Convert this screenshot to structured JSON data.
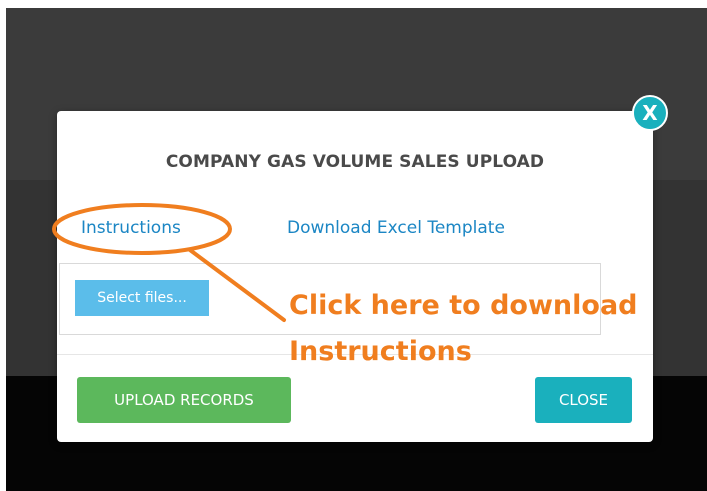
{
  "modal": {
    "title": "COMPANY GAS VOLUME SALES UPLOAD",
    "close_x_label": "X",
    "links": {
      "instructions": "Instructions",
      "template": "Download Excel Template"
    },
    "upload": {
      "select_files_label": "Select files..."
    },
    "buttons": {
      "upload_records": "UPLOAD RECORDS",
      "close": "CLOSE"
    }
  },
  "annotation": {
    "line1": "Click here to download",
    "line2": "Instructions",
    "color": "#f07e1f"
  },
  "colors": {
    "link": "#1b86c4",
    "upload_button": "#5cb85c",
    "close_button": "#1ab0bd",
    "select_files": "#5bbdea"
  }
}
